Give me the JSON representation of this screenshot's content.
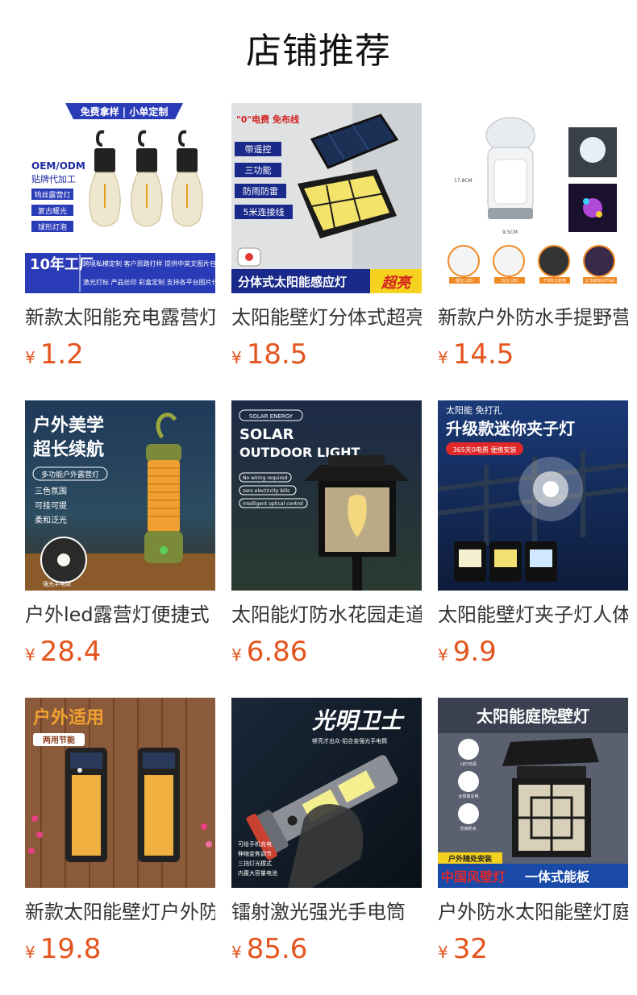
{
  "page": {
    "title": "店铺推荐",
    "currency_symbol": "¥",
    "accent_color": "#e4541e"
  },
  "products": [
    {
      "name": "新款太阳能充电露营灯",
      "price": "1.2",
      "image": {
        "banner": "免费拿样 | 小单定制",
        "oem": "OEM/ODM",
        "oem_sub": "贴牌代加工",
        "tags": [
          "钨丝露营灯",
          "复古暖光",
          "球形灯泡"
        ],
        "badge": "10年工厂",
        "footer_top": "跨境私模定制  客户思路打样  提供中英文图片包  认证齐全",
        "footer_bottom": "激光打标  产品丝印  彩盒定制  支持各平台图片代发"
      }
    },
    {
      "name": "太阳能壁灯分体式超亮",
      "price": "18.5",
      "image": {
        "corner": "\"0\"电费 免布线",
        "tags": [
          "带遥控",
          "三功能",
          "防雨防雷",
          "5米连接线"
        ],
        "footer": "分体式太阳能感应灯",
        "footer_em": "超亮"
      }
    },
    {
      "name": "新款户外防水手提野营灯",
      "price": "14.5",
      "image": {
        "dim_height": "17.8CM",
        "dim_width": "9.5CM",
        "labels": [
          "暖光 LED",
          "白光 LED",
          "TYPE-C充电",
          "1*18650/3*AA"
        ]
      }
    },
    {
      "name": "户外led露营灯便捷式",
      "price": "28.4",
      "image": {
        "headline_1": "户外美学",
        "headline_2": "超长续航",
        "pill": "多功能户外露营灯",
        "features": [
          "三色氛围",
          "可挂可提",
          "柔和泛光"
        ],
        "caption": "强光手电筒"
      }
    },
    {
      "name": "太阳能灯防水花园走道灯",
      "price": "6.86",
      "image": {
        "tag": "SOLAR ENERGY",
        "headline_1": "SOLAR",
        "headline_2": "OUTDOOR LIGHT",
        "pills": [
          "No wiring required",
          "zero electricity bills",
          "intelligent optical control"
        ]
      }
    },
    {
      "name": "太阳能壁灯夹子灯人体感应",
      "price": "9.9",
      "image": {
        "top": "太阳能 免打孔",
        "headline": "升级款迷你夹子灯",
        "badge": "365天0电费 便携安装"
      }
    },
    {
      "name": "新款太阳能壁灯户外防水",
      "price": "19.8",
      "image": {
        "headline": "户外适用",
        "badge": "两用节能"
      }
    },
    {
      "name": "镭射激光强光手电筒",
      "price": "85.6",
      "image": {
        "headline": "光明卫士",
        "sub": "够亮才出众·铝合金强光手电筒",
        "features": [
          "可给手机充电",
          "伸缩变焦调节",
          "三挡灯光模式",
          "内置大容量电池"
        ]
      }
    },
    {
      "name": "户外防水太阳能壁灯庭院灯",
      "price": "32",
      "image": {
        "headline": "太阳能庭院壁灯",
        "icons": [
          "LED光源",
          "太阳能充电",
          "防雨防水"
        ],
        "badge": "户外随处安装",
        "footer_red": "中国风壁灯",
        "footer_white": "一体式能板"
      }
    }
  ]
}
